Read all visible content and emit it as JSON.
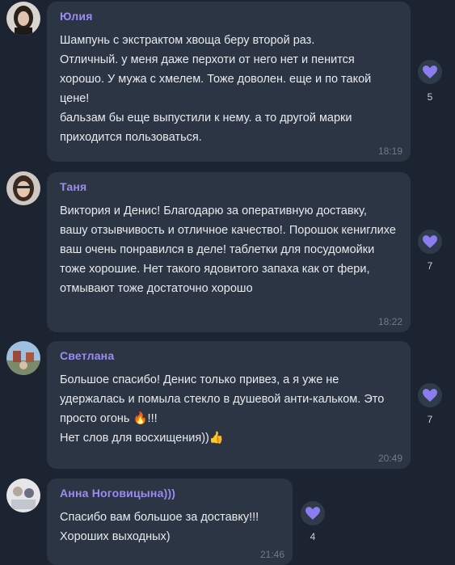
{
  "messages": [
    {
      "author": "Юлия",
      "text": "Шампунь с экстрактом хвоща беру второй раз.\nОтличный. у меня даже перхоти от него нет и пенится хорошо. У мужа с хмелем. Тоже доволен. еще и по такой цене!\nбальзам бы еще выпустили к нему. а то другой марки приходится пользоваться.",
      "time": "18:19",
      "reaction_icon": "purple-heart",
      "reaction_count": "5"
    },
    {
      "author": "Таня",
      "text": "Виктория и Денис! Благодарю за оперативную доставку, вашу отзывчивость и отличное качество!. Порошок кениглихе ваш очень понравился в деле! таблетки для посудомойки тоже хорошие. Нет такого ядовитого запаха как от фери, отмывают тоже достаточно хорошо",
      "time": "18:22",
      "reaction_icon": "purple-heart",
      "reaction_count": "7"
    },
    {
      "author": "Светлана",
      "text": "Большое спасибо! Денис только привез, а я уже не удержалась и помыла стекло в душевой анти-кальком. Это просто огонь 🔥!!!\nНет слов для восхищения))👍",
      "time": "20:49",
      "reaction_icon": "purple-heart",
      "reaction_count": "7"
    },
    {
      "author": "Анна Ноговицына)))",
      "text": "Спасибо вам большое за доставку!!!\nХороших выходных)",
      "time": "21:46",
      "reaction_icon": "purple-heart",
      "reaction_count": "4"
    }
  ],
  "colors": {
    "background": "#1b2430",
    "bubble": "#2b3543",
    "author": "#9c8cf0",
    "heart": "#8b7cf0"
  }
}
